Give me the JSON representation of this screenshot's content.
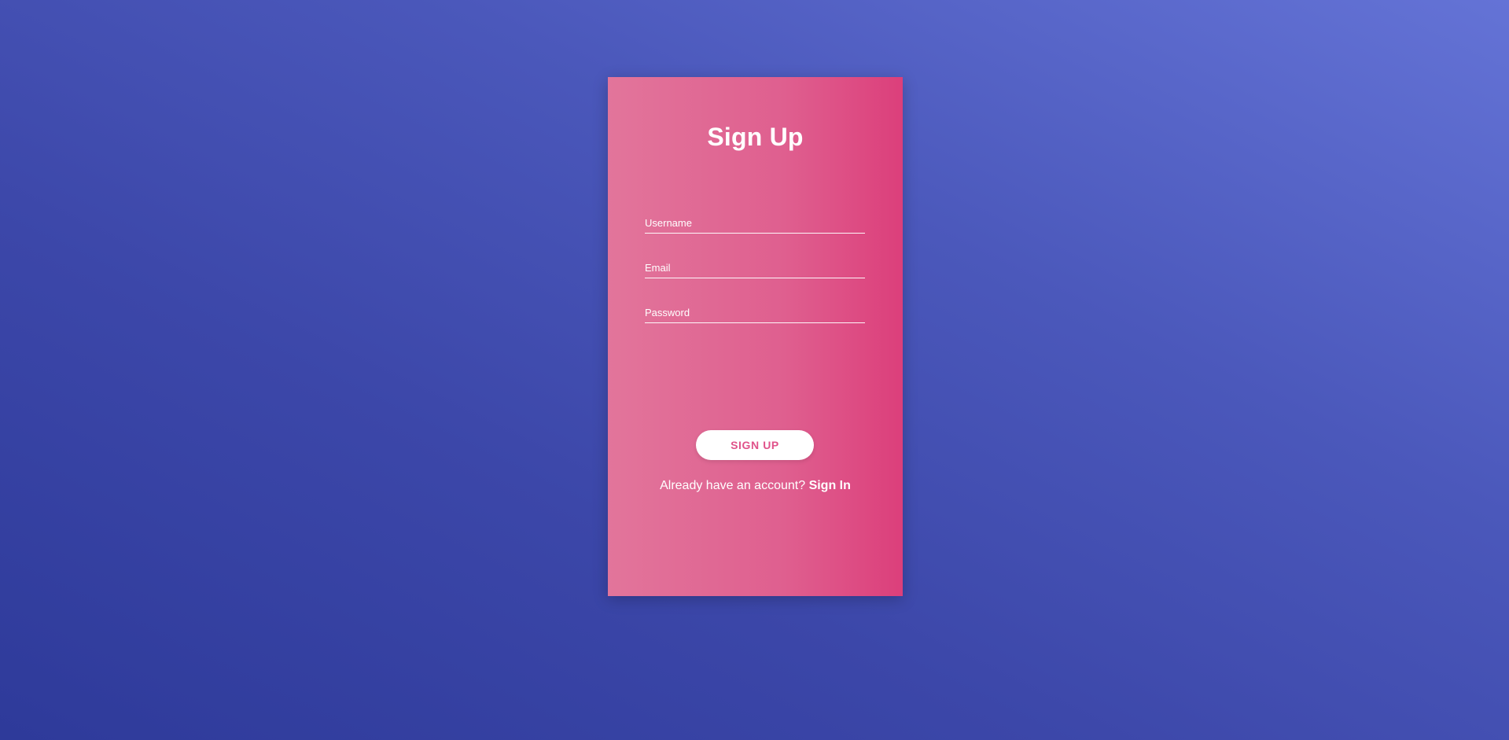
{
  "form": {
    "title": "Sign Up",
    "fields": [
      {
        "name": "username",
        "placeholder": "Username",
        "value": ""
      },
      {
        "name": "email",
        "placeholder": "Email",
        "value": ""
      },
      {
        "name": "password",
        "placeholder": "Password",
        "value": ""
      }
    ],
    "submit_label": "SIGN UP",
    "footer_prompt": "Already have an account?",
    "footer_link": "Sign In"
  },
  "colors": {
    "background_start": "#2e3a9a",
    "background_end": "#6473d6",
    "card_start": "#e2759b",
    "card_end": "#dc3f7b",
    "button_text": "#e0528a"
  }
}
